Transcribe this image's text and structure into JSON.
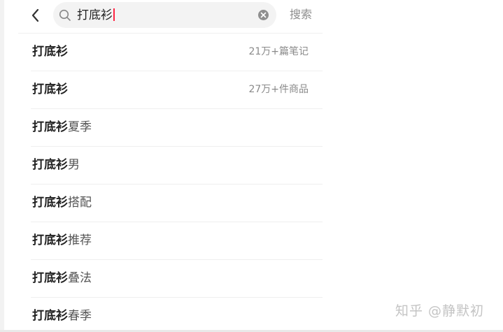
{
  "search": {
    "query": "打底衫",
    "submit_label": "搜索"
  },
  "suggestions": [
    {
      "bold": "打底衫",
      "rest": "",
      "meta": "21万+篇笔记"
    },
    {
      "bold": "打底衫",
      "rest": "",
      "meta": "27万+件商品"
    },
    {
      "bold": "打底衫",
      "rest": "夏季",
      "meta": ""
    },
    {
      "bold": "打底衫",
      "rest": "男",
      "meta": ""
    },
    {
      "bold": "打底衫",
      "rest": "搭配",
      "meta": ""
    },
    {
      "bold": "打底衫",
      "rest": "推荐",
      "meta": ""
    },
    {
      "bold": "打底衫",
      "rest": "叠法",
      "meta": ""
    },
    {
      "bold": "打底衫",
      "rest": "春季",
      "meta": ""
    }
  ],
  "watermark": "知乎 @静默初",
  "icons": {
    "back": "chevron-left-icon",
    "search": "search-icon",
    "clear": "clear-icon"
  },
  "colors": {
    "caret": "#ff2442",
    "search_bg": "#f3f3f3",
    "muted_text": "#8d8d8d"
  }
}
